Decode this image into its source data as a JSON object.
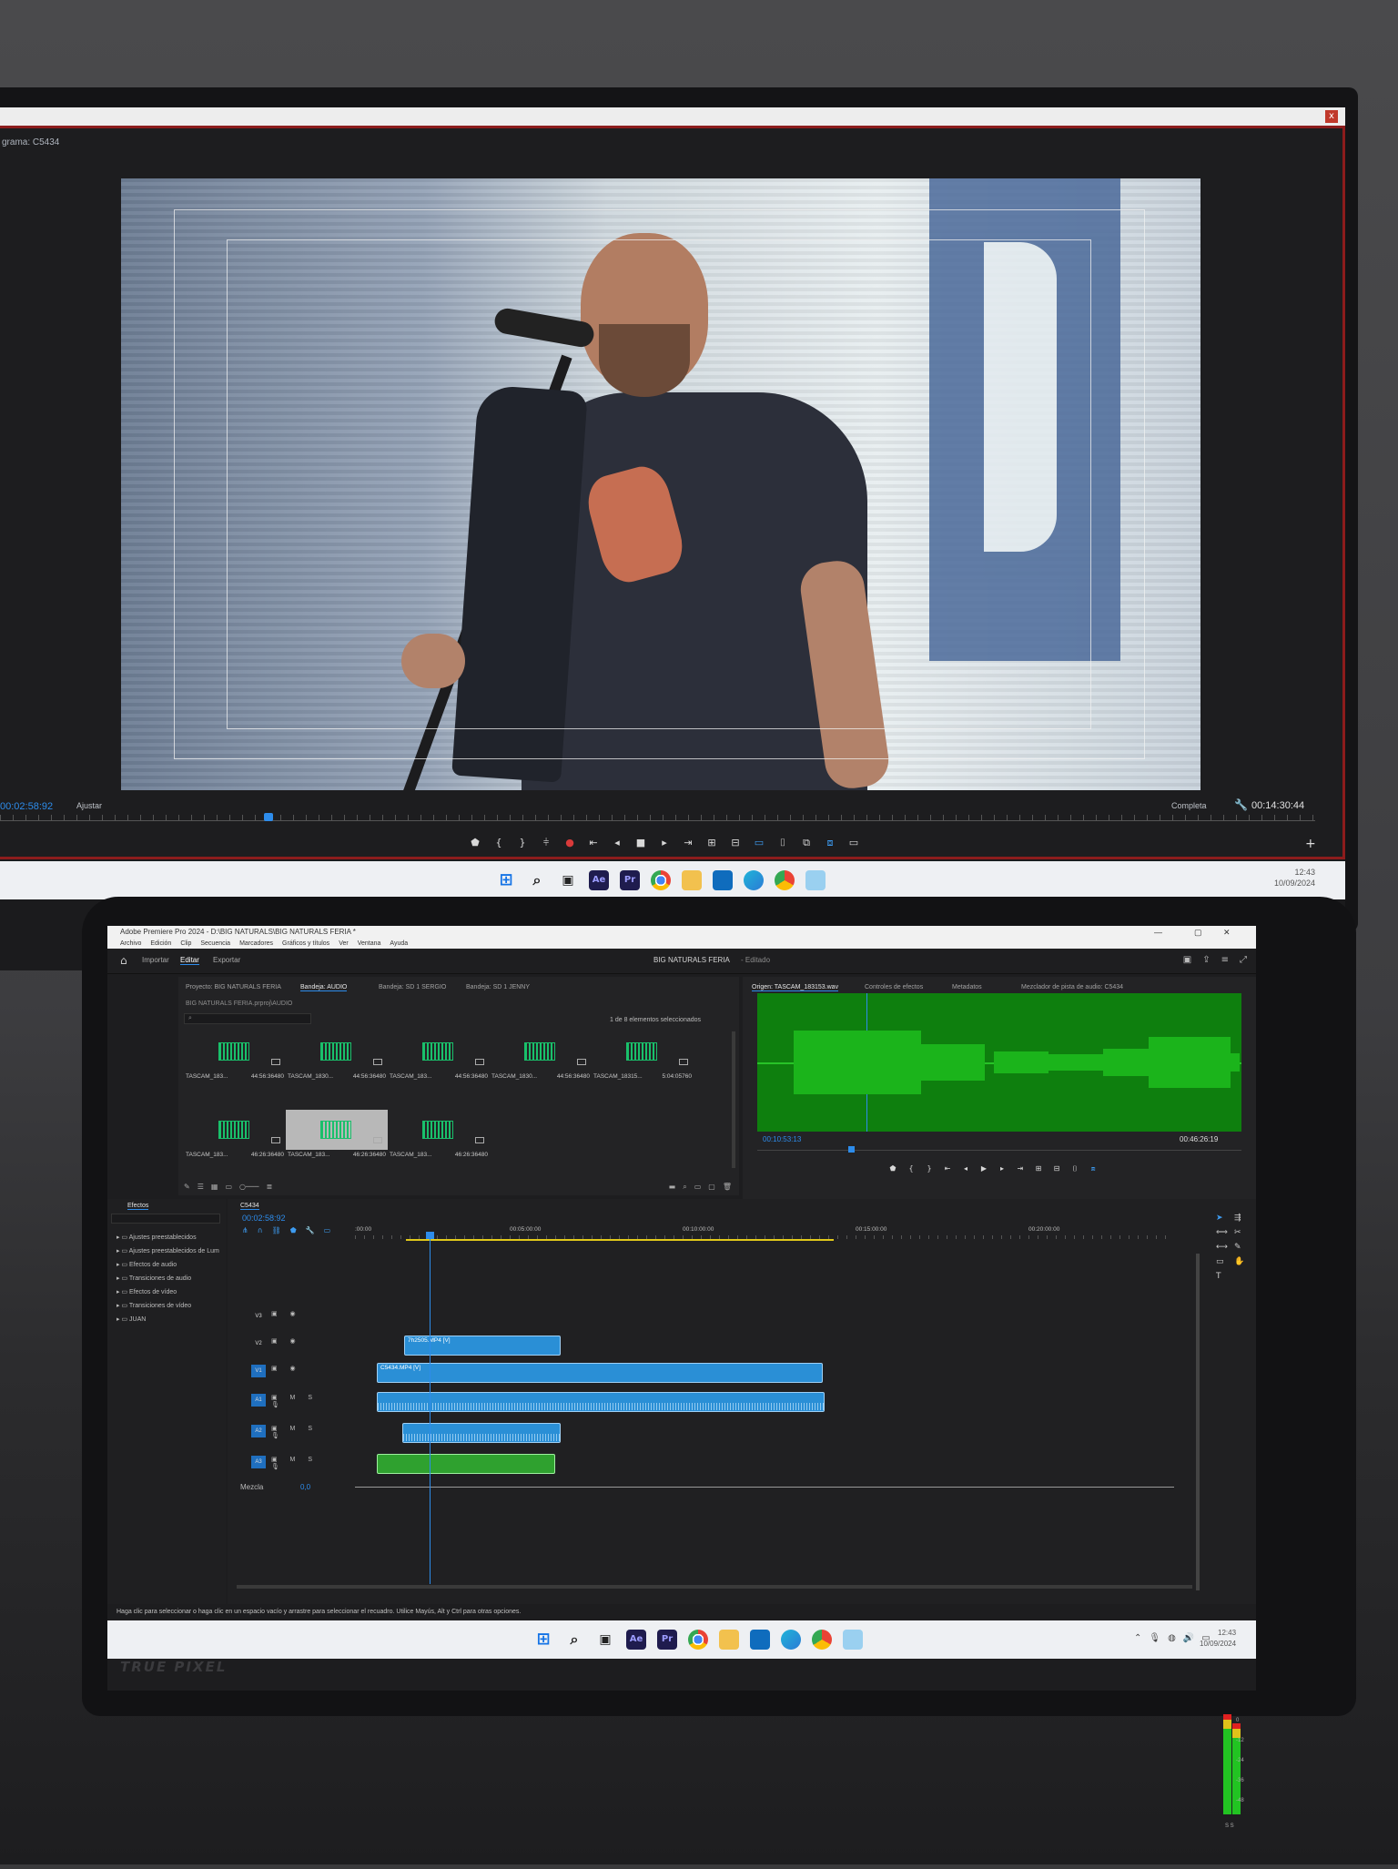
{
  "top_monitor": {
    "program_label": "grama: C5434",
    "timecode": "00:02:58:92",
    "fit": "Ajustar",
    "quality": "Completa",
    "duration": "00:14:30:44",
    "clock_time": "12:43",
    "clock_date": "10/09/2024",
    "close_glyph": "x"
  },
  "app": {
    "title": "Adobe Premiere Pro 2024 - D:\\BIG NATURALS\\BIG NATURALS FERIA *",
    "menu": [
      "Archivo",
      "Edición",
      "Clip",
      "Secuencia",
      "Marcadores",
      "Gráficos y títulos",
      "Ver",
      "Ventana",
      "Ayuda"
    ],
    "nav": {
      "import": "Importar",
      "edit": "Editar",
      "export": "Exportar"
    },
    "project_title": "BIG NATURALS FERIA",
    "project_status": "- Editado"
  },
  "project_panel": {
    "tabs": [
      "Proyecto: BIG NATURALS FERIA",
      "Bandeja: AUDIO",
      "Bandeja: SD 1 SERGIO",
      "Bandeja: SD 1 JENNY"
    ],
    "path": "BIG NATURALS FERIA.prproj\\AUDIO",
    "count": "1 de 8 elementos seleccionados",
    "clips": [
      {
        "name": "TASCAM_183...",
        "dur": "44:56:36480"
      },
      {
        "name": "TASCAM_1830...",
        "dur": "44:56:36480"
      },
      {
        "name": "TASCAM_183...",
        "dur": "44:56:36480"
      },
      {
        "name": "TASCAM_1830...",
        "dur": "44:56:36480"
      },
      {
        "name": "TASCAM_18315...",
        "dur": "5:04:05760"
      },
      {
        "name": "TASCAM_183...",
        "dur": "46:26:36480"
      },
      {
        "name": "TASCAM_183...",
        "dur": "46:26:36480"
      },
      {
        "name": "TASCAM_183...",
        "dur": "46:26:36480"
      }
    ]
  },
  "source_panel": {
    "tabs": [
      "Origen: TASCAM_183153.wav",
      "Controles de efectos",
      "Metadatos",
      "Mezclador de pista de audio: C5434"
    ],
    "timecode": "00:10:53:13",
    "duration": "00:46:26:19"
  },
  "effects_panel": {
    "title": "Efectos",
    "items": [
      "Ajustes preestablecidos",
      "Ajustes preestablecidos de Lum",
      "Efectos de audio",
      "Transiciones de audio",
      "Efectos de vídeo",
      "Transiciones de vídeo",
      "JUAN"
    ]
  },
  "timeline": {
    "sequence": "C5434",
    "timecode": "00:02:58:92",
    "ruler": [
      ":00:00",
      "00:05:00:00",
      "00:10:00:00",
      "00:15:00:00",
      "00:20:00:00"
    ],
    "tracks": [
      {
        "label": "V3"
      },
      {
        "label": "V2"
      },
      {
        "label": "V1"
      },
      {
        "label": "A1"
      },
      {
        "label": "A2"
      },
      {
        "label": "A3"
      }
    ],
    "clips": {
      "v2": "7h2505.MP4 [V]",
      "v1": "C5434.MP4 [V]"
    },
    "mix_label": "Mezcla",
    "mix_value": "0,0",
    "meter_labels": [
      "0",
      "-12",
      "-24",
      "-36",
      "-48"
    ],
    "meter_foot": "S S"
  },
  "status_bar": "Haga clic para seleccionar o haga clic en un espacio vacío y arrastre para seleccionar el recuadro. Utilice Mayús, Alt y Ctrl para otras opciones.",
  "laptop_taskbar": {
    "clock_time": "12:43",
    "clock_date": "10/09/2024"
  },
  "brand": "TRUE PIXEL",
  "icons": {
    "windows": "windows-icon",
    "search": "search-icon",
    "ae": "Ae",
    "pr": "Pr"
  }
}
